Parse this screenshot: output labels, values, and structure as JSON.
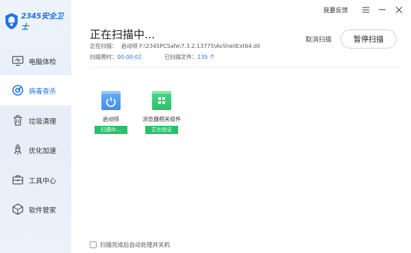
{
  "app": {
    "brand": "2345安全卫士"
  },
  "colors": {
    "accent": "#1e72e8",
    "success": "#2bbf6a"
  },
  "topbar": {
    "feedback": "我要反馈",
    "menu_icon": "menu-icon",
    "minimize_icon": "minimize-icon",
    "close_icon": "close-icon"
  },
  "sidebar": {
    "items": [
      {
        "label": "电脑体检",
        "icon": "monitor-icon",
        "active": false
      },
      {
        "label": "病毒查杀",
        "icon": "virus-scan-icon",
        "active": true
      },
      {
        "label": "垃圾清理",
        "icon": "trash-icon",
        "active": false
      },
      {
        "label": "优化加速",
        "icon": "rocket-icon",
        "active": false
      },
      {
        "label": "工具中心",
        "icon": "toolbox-icon",
        "active": false
      },
      {
        "label": "软件管家",
        "icon": "software-icon",
        "active": false
      }
    ]
  },
  "scan": {
    "title": "正在扫描中...",
    "scanning_label": "正在扫描：",
    "scanning_path": "启动项 F:\\2345PCSafe\\7.3.2.13775\\AvShellExt64.dll",
    "time_label": "扫描用时：",
    "time_value": "00:00:02",
    "files_label": "已扫描文件：",
    "files_value": "235 个",
    "cancel": "取消扫描",
    "pause": "暂停扫描"
  },
  "tiles": [
    {
      "label": "启动项",
      "status": "扫描中...",
      "icon": "power-icon"
    },
    {
      "label": "浏览器相关组件",
      "status": "正在验证",
      "icon": "browser-components-icon"
    }
  ],
  "footer": {
    "auto_shutdown": "扫描完成后自动处理并关机",
    "checked": false
  }
}
